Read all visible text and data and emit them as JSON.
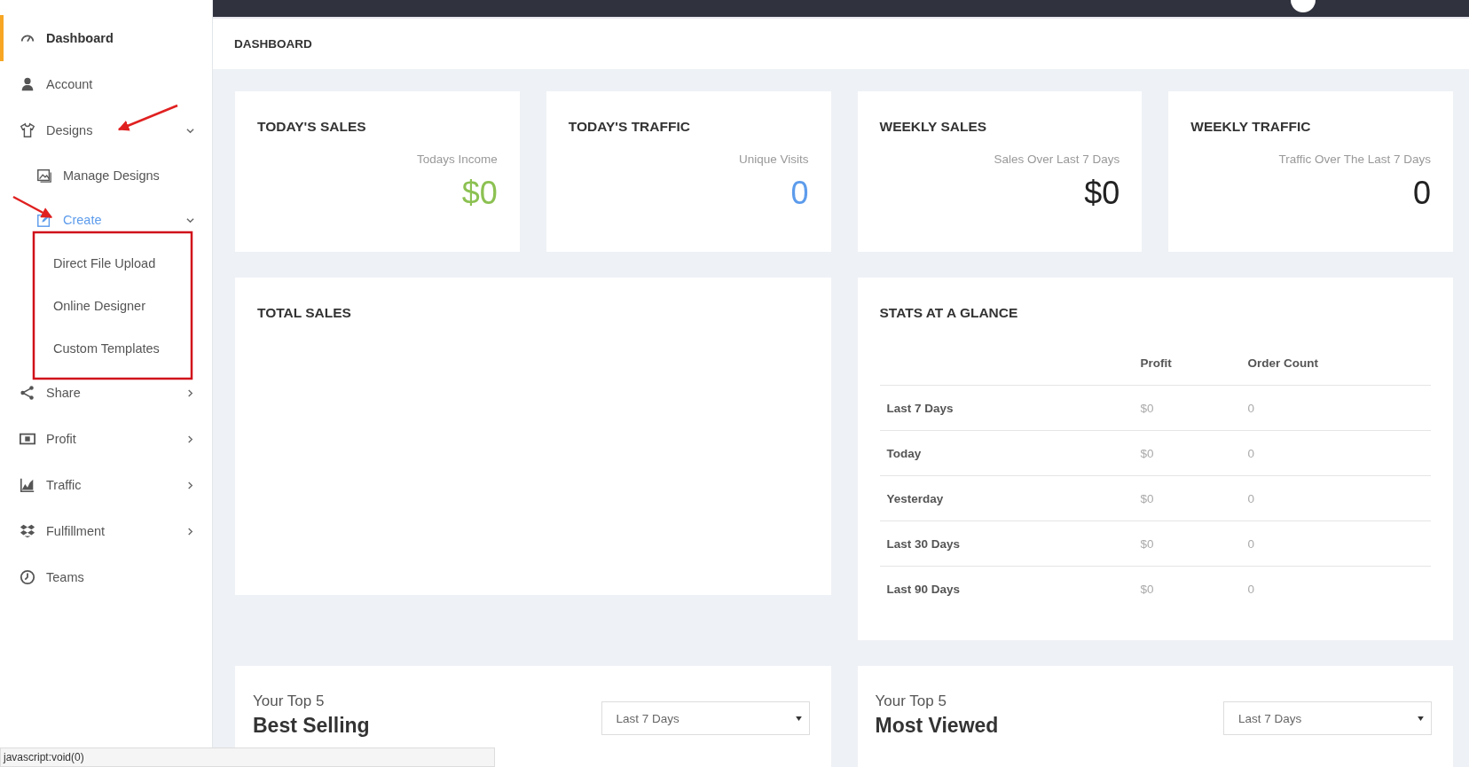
{
  "sidebar": {
    "items": [
      {
        "label": "Dashboard",
        "selected": true,
        "hovered": false
      },
      {
        "label": "Account",
        "selected": false,
        "hovered": false
      },
      {
        "label": "Designs",
        "selected": false,
        "hovered": false,
        "expanded": true,
        "children": [
          {
            "label": "Manage Designs",
            "selected": false,
            "hovered": false
          },
          {
            "label": "Create",
            "selected": false,
            "hovered": true,
            "expanded": true,
            "children": [
              {
                "label": "Direct File Upload",
                "selected": false,
                "hovered": false
              },
              {
                "label": "Online Designer",
                "selected": false,
                "hovered": false
              },
              {
                "label": "Custom Templates",
                "selected": false,
                "hovered": false
              }
            ]
          }
        ]
      },
      {
        "label": "Share",
        "selected": false,
        "hovered": false,
        "expanded": false
      },
      {
        "label": "Profit",
        "selected": false,
        "hovered": false,
        "expanded": false
      },
      {
        "label": "Traffic",
        "selected": false,
        "hovered": false,
        "expanded": false
      },
      {
        "label": "Fulfillment",
        "selected": false,
        "hovered": false,
        "expanded": false
      },
      {
        "label": "Teams",
        "selected": false,
        "hovered": false
      }
    ]
  },
  "page_title": "DASHBOARD",
  "stat_cards": [
    {
      "title": "TODAY'S SALES",
      "caption": "Todays Income",
      "value": "$0",
      "color": "#8cc152"
    },
    {
      "title": "TODAY'S TRAFFIC",
      "caption": "Unique Visits",
      "value": "0",
      "color": "#5d9cec"
    },
    {
      "title": "WEEKLY SALES",
      "caption": "Sales Over Last 7 Days",
      "value": "$0",
      "color": "#222222"
    },
    {
      "title": "WEEKLY TRAFFIC",
      "caption": "Traffic Over The Last 7 Days",
      "value": "0",
      "color": "#222222"
    }
  ],
  "total_sales": {
    "title": "TOTAL SALES"
  },
  "stats": {
    "title": "STATS AT A GLANCE",
    "columns": [
      "Profit",
      "Order Count"
    ],
    "rows": [
      {
        "label": "Last 7 Days",
        "profit": "$0",
        "order_count": "0"
      },
      {
        "label": "Today",
        "profit": "$0",
        "order_count": "0"
      },
      {
        "label": "Yesterday",
        "profit": "$0",
        "order_count": "0"
      },
      {
        "label": "Last 30 Days",
        "profit": "$0",
        "order_count": "0"
      },
      {
        "label": "Last 90 Days",
        "profit": "$0",
        "order_count": "0"
      }
    ]
  },
  "top_cards": [
    {
      "subtitle": "Your Top 5",
      "title": "Best Selling",
      "period": "Last 7 Days"
    },
    {
      "subtitle": "Your Top 5",
      "title": "Most Viewed",
      "period": "Last 7 Days"
    }
  ],
  "status_bar": "javascript:void(0)"
}
